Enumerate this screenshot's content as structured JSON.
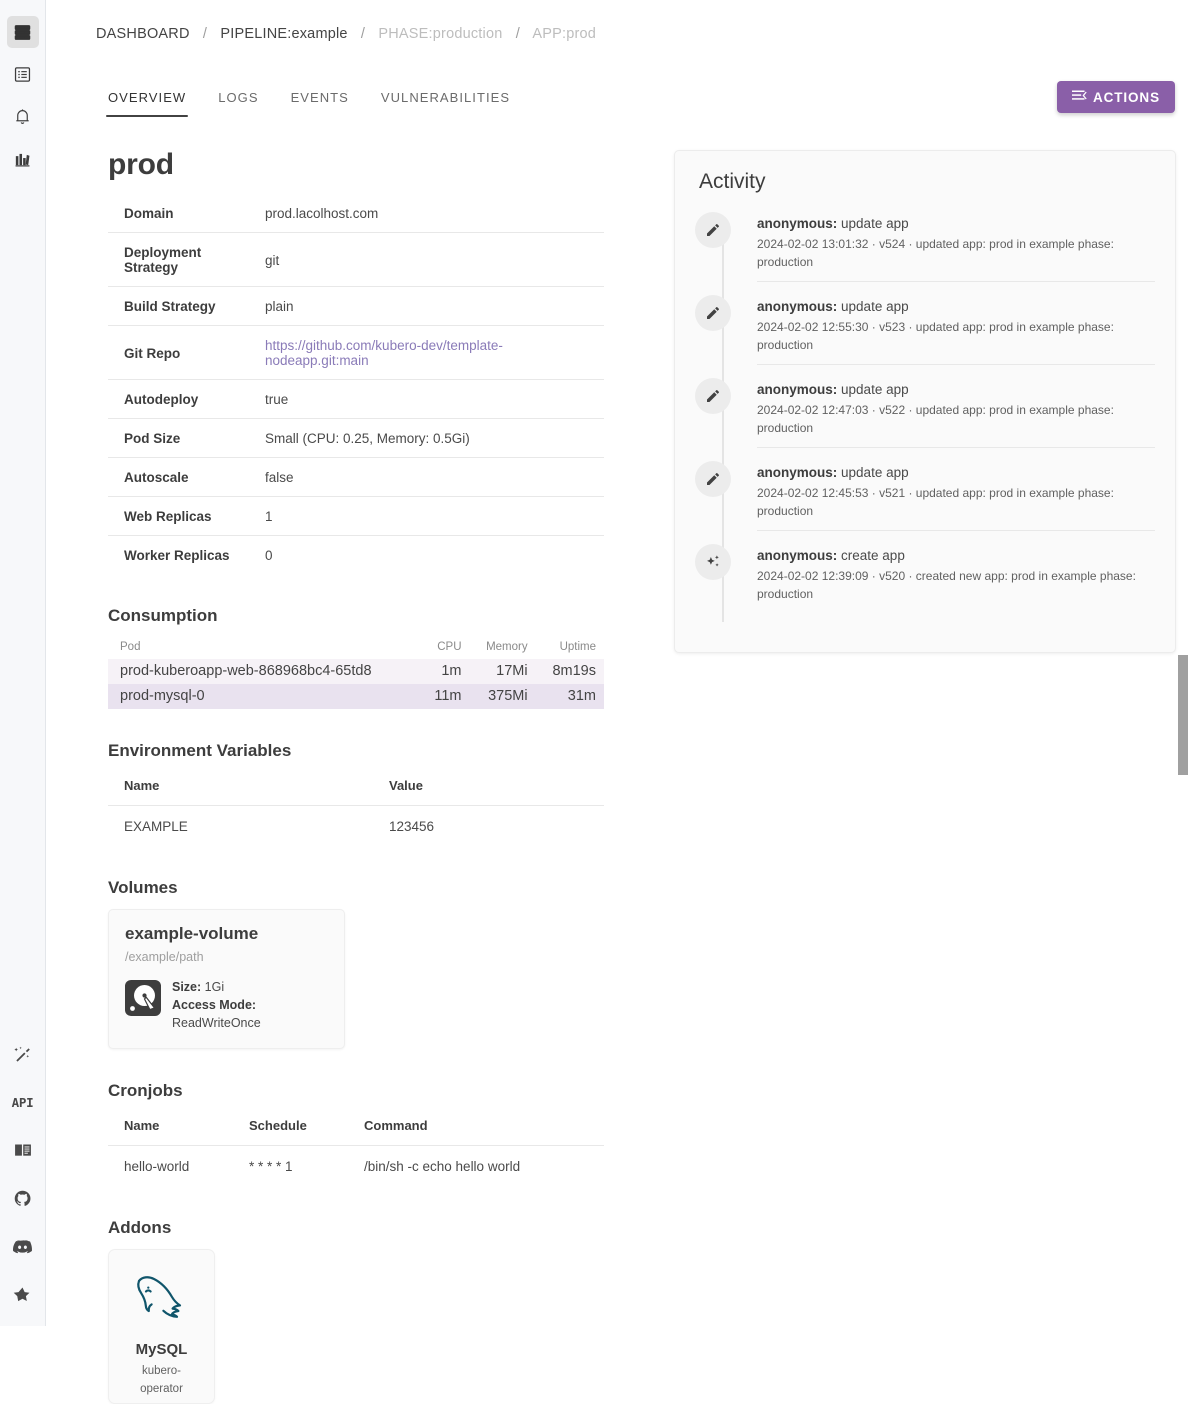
{
  "rail": {
    "top_items": [
      {
        "name": "dashboard-icon",
        "label": "Dashboard",
        "active": true
      },
      {
        "name": "pipelines-icon",
        "label": "Pipelines",
        "active": false
      },
      {
        "name": "notifications-bell-icon",
        "label": "Notifications",
        "active": false
      },
      {
        "name": "templates-icon",
        "label": "Templates",
        "active": false
      }
    ],
    "bottom_items": [
      {
        "name": "magic-wand-icon",
        "label": "Magic"
      },
      {
        "name": "api-icon",
        "label": "API"
      },
      {
        "name": "docs-book-icon",
        "label": "Docs"
      },
      {
        "name": "github-icon",
        "label": "GitHub"
      },
      {
        "name": "discord-icon",
        "label": "Discord"
      },
      {
        "name": "star-icon",
        "label": "Star"
      }
    ]
  },
  "breadcrumb": [
    {
      "label": "DASHBOARD",
      "muted": false
    },
    {
      "label": "PIPELINE:example",
      "muted": false
    },
    {
      "label": "PHASE:production",
      "muted": true
    },
    {
      "label": "APP:prod",
      "muted": true
    }
  ],
  "breadcrumb_separator": "/",
  "tabs": [
    {
      "label": "OVERVIEW",
      "active": true
    },
    {
      "label": "LOGS",
      "active": false
    },
    {
      "label": "EVENTS",
      "active": false
    },
    {
      "label": "VULNERABILITIES",
      "active": false
    }
  ],
  "actions_button": {
    "label": "ACTIONS",
    "color": "#8a5fa8"
  },
  "app": {
    "title": "prod",
    "details": [
      {
        "key": "Domain",
        "value": "prod.lacolhost.com",
        "link": false
      },
      {
        "key": "Deployment Strategy",
        "value": "git",
        "link": false
      },
      {
        "key": "Build Strategy",
        "value": "plain",
        "link": false
      },
      {
        "key": "Git Repo",
        "value": "https://github.com/kubero-dev/template-nodeapp.git:main",
        "link": true
      },
      {
        "key": "Autodeploy",
        "value": "true",
        "link": false
      },
      {
        "key": "Pod Size",
        "value": "Small (CPU: 0.25, Memory: 0.5Gi)",
        "link": false
      },
      {
        "key": "Autoscale",
        "value": "false",
        "link": false
      },
      {
        "key": "Web Replicas",
        "value": "1",
        "link": false
      },
      {
        "key": "Worker Replicas",
        "value": "0",
        "link": false
      }
    ]
  },
  "consumption": {
    "heading": "Consumption",
    "columns": [
      "Pod",
      "CPU",
      "Memory",
      "Uptime"
    ],
    "rows": [
      {
        "pod": "prod-kuberoapp-web-868968bc4-65td8",
        "cpu": "1m",
        "memory": "17Mi",
        "uptime": "8m19s"
      },
      {
        "pod": "prod-mysql-0",
        "cpu": "11m",
        "memory": "375Mi",
        "uptime": "31m"
      }
    ],
    "row_colors": [
      "#f6f2f7",
      "#e9e2ef"
    ]
  },
  "environment_variables": {
    "heading": "Environment Variables",
    "columns": [
      "Name",
      "Value"
    ],
    "rows": [
      {
        "name": "EXAMPLE",
        "value": "123456"
      }
    ]
  },
  "volumes": {
    "heading": "Volumes",
    "items": [
      {
        "name": "example-volume",
        "path": "/example/path",
        "size_label": "Size:",
        "size_value": "1Gi",
        "access_mode_label": "Access Mode:",
        "access_mode_value": "ReadWriteOnce",
        "icon": "harddisk-icon"
      }
    ]
  },
  "cronjobs": {
    "heading": "Cronjobs",
    "columns": [
      "Name",
      "Schedule",
      "Command"
    ],
    "rows": [
      {
        "name": "hello-world",
        "schedule": "* * * * 1",
        "command": "/bin/sh -c echo hello world"
      }
    ]
  },
  "addons": {
    "heading": "Addons",
    "items": [
      {
        "name": "MySQL",
        "provider": "kubero-operator",
        "icon": "mysql-dolphin-icon",
        "icon_color": "#10556b"
      }
    ]
  },
  "activity": {
    "heading": "Activity",
    "items": [
      {
        "actor": "anonymous:",
        "action": "update app",
        "detail": "2024-02-02 13:01:32 · v524 · updated app: prod in example phase: production",
        "icon": "pencil-icon"
      },
      {
        "actor": "anonymous:",
        "action": "update app",
        "detail": "2024-02-02 12:55:30 · v523 · updated app: prod in example phase: production",
        "icon": "pencil-icon"
      },
      {
        "actor": "anonymous:",
        "action": "update app",
        "detail": "2024-02-02 12:47:03 · v522 · updated app: prod in example phase: production",
        "icon": "pencil-icon"
      },
      {
        "actor": "anonymous:",
        "action": "update app",
        "detail": "2024-02-02 12:45:53 · v521 · updated app: prod in example phase: production",
        "icon": "pencil-icon"
      },
      {
        "actor": "anonymous:",
        "action": "create app",
        "detail": "2024-02-02 12:39:09 · v520 · created new app: prod in example phase: production",
        "icon": "sparkle-icon"
      }
    ]
  }
}
